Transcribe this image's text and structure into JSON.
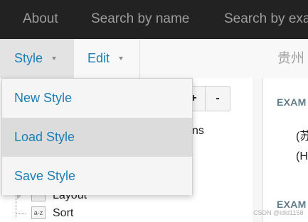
{
  "topnav": {
    "links": [
      {
        "label": "About"
      },
      {
        "label": "Search by name"
      },
      {
        "label": "Search by exa"
      }
    ]
  },
  "toolbar": {
    "style_label": "Style",
    "edit_label": "Edit",
    "region_title": "贵州"
  },
  "style_menu": {
    "items": [
      {
        "label": "New Style"
      },
      {
        "label": "Load Style"
      },
      {
        "label": "Save Style"
      }
    ],
    "highlighted_index": 1
  },
  "left_panel": {
    "plus_label": "+",
    "minus_label": "-",
    "partial_text": "ns",
    "tree": [
      {
        "label": "Layout",
        "icon": "layout-icon",
        "icon_text": ""
      },
      {
        "label": "Sort",
        "icon": "sort-az-icon",
        "icon_text": "a-z"
      }
    ]
  },
  "right_panel": {
    "headings": [
      "EXAM",
      "EXAM"
    ],
    "lines": [
      "(苏",
      "(H"
    ]
  },
  "watermark": "CSDN @idid1158"
}
